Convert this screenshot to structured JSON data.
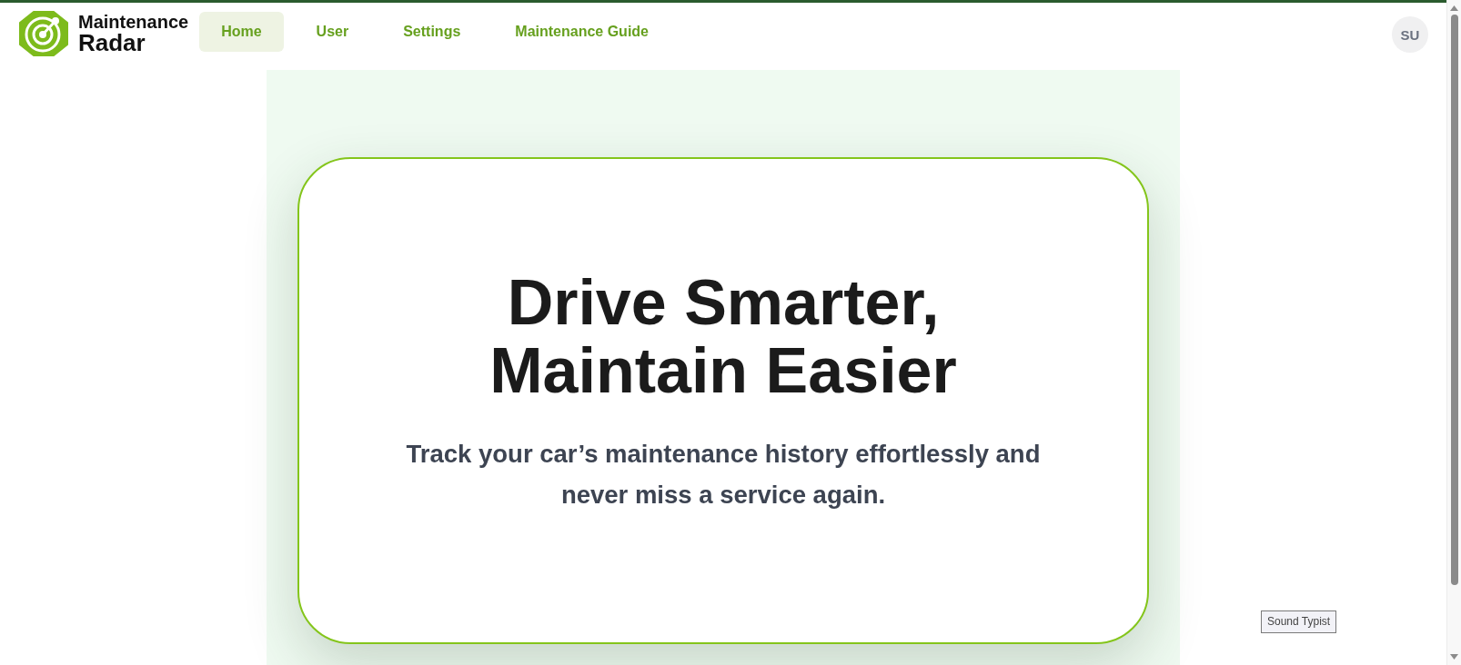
{
  "header": {
    "logo": {
      "line_1": "Maintenance",
      "line_2": "Radar"
    },
    "nav": [
      {
        "label": "Home",
        "selected": true
      },
      {
        "label": "User",
        "selected": false
      },
      {
        "label": "Settings",
        "selected": false
      },
      {
        "label": "Maintenance Guide",
        "selected": false
      }
    ],
    "avatar": {
      "initials": "SU"
    }
  },
  "hero": {
    "title": "Drive Smarter, Maintain Easier",
    "subtitle": "Track your car’s maintenance history effortlessly and never miss a service again."
  },
  "tooltip": {
    "text": "Sound Typist"
  }
}
